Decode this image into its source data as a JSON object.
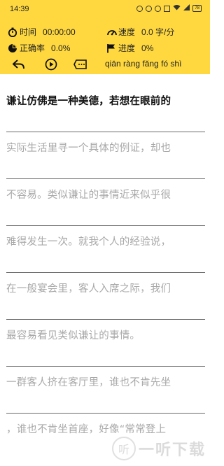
{
  "status_bar": {
    "time": "14:39",
    "battery": "78"
  },
  "toolbar": {
    "time_label": "时间",
    "time_value": "00:00:00",
    "speed_label": "速度",
    "speed_value": "0.0 字/分",
    "accuracy_label": "正确率",
    "accuracy_value": "0.0%",
    "progress_label": "进度",
    "progress_value": "0%",
    "pinyin": "qiān ràng fǎng fó shì"
  },
  "lines": [
    {
      "text": "谦让仿佛是一种美德，若想在眼前的",
      "state": "done"
    },
    {
      "text": "实际生活里寻一个具体的例证，却也",
      "state": "pending"
    },
    {
      "text": "不容易。类似谦让的事情近来似乎很",
      "state": "pending"
    },
    {
      "text": "难得发生一次。就我个人的经验说，",
      "state": "pending"
    },
    {
      "text": "在一般宴会里，客人入席之际，我们",
      "state": "pending"
    },
    {
      "text": "最容易看见类似谦让的事情。",
      "state": "pending"
    },
    {
      "text": "一群客人挤在客厅里，谁也不肯先坐",
      "state": "pending"
    },
    {
      "text": "，谁也不肯坐首座，好像“常常登上",
      "state": "pending"
    }
  ],
  "watermark": {
    "glyph": "听",
    "text": "一听下载"
  }
}
